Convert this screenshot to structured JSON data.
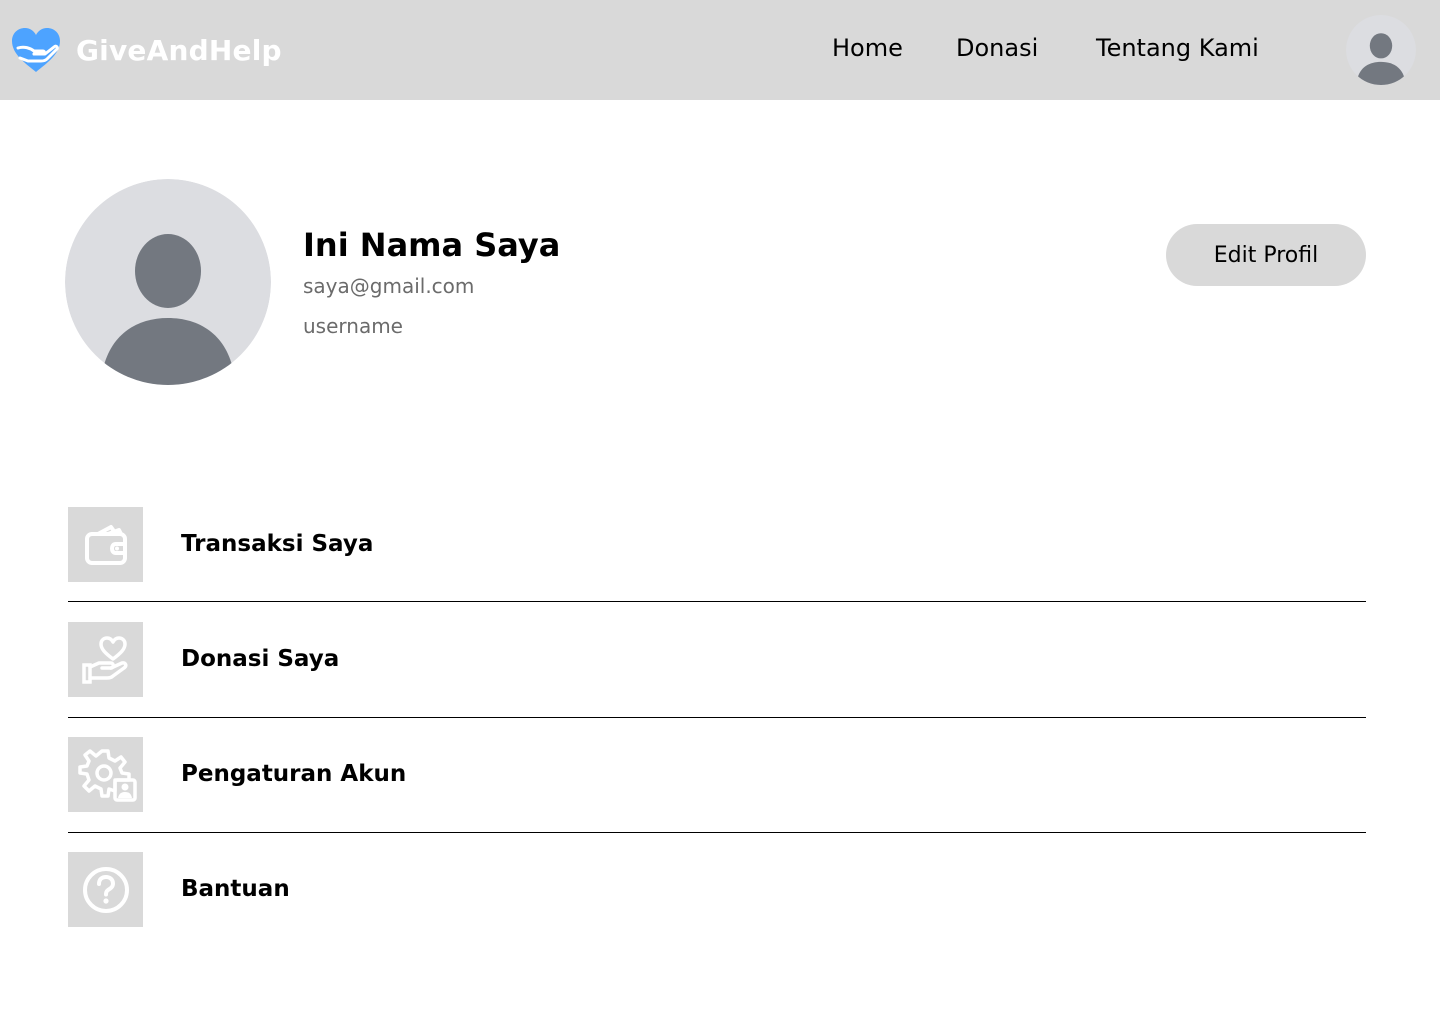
{
  "header": {
    "brand": {
      "name": "GiveAndHelp",
      "icon": "heart-hand-logo-icon",
      "color": "#4da3ff"
    },
    "nav": [
      {
        "label": "Home"
      },
      {
        "label": "Donasi"
      },
      {
        "label": "Tentang Kami"
      }
    ],
    "avatar_icon": "user-avatar-icon"
  },
  "profile": {
    "name": "Ini Nama Saya",
    "email": "saya@gmail.com",
    "username": "username",
    "avatar_icon": "user-avatar-icon",
    "edit_button": "Edit Profil"
  },
  "menu": [
    {
      "label": "Transaksi Saya",
      "icon": "wallet-icon"
    },
    {
      "label": "Donasi Saya",
      "icon": "hand-heart-icon"
    },
    {
      "label": "Pengaturan Akun",
      "icon": "gear-user-icon"
    },
    {
      "label": "Bantuan",
      "icon": "question-circle-icon"
    }
  ],
  "colors": {
    "header_bg": "#d9d9d9",
    "brand_accent": "#4da3ff",
    "avatar_bg": "#dcdde1",
    "avatar_fg": "#737880",
    "secondary_text": "#6b6b6b"
  }
}
